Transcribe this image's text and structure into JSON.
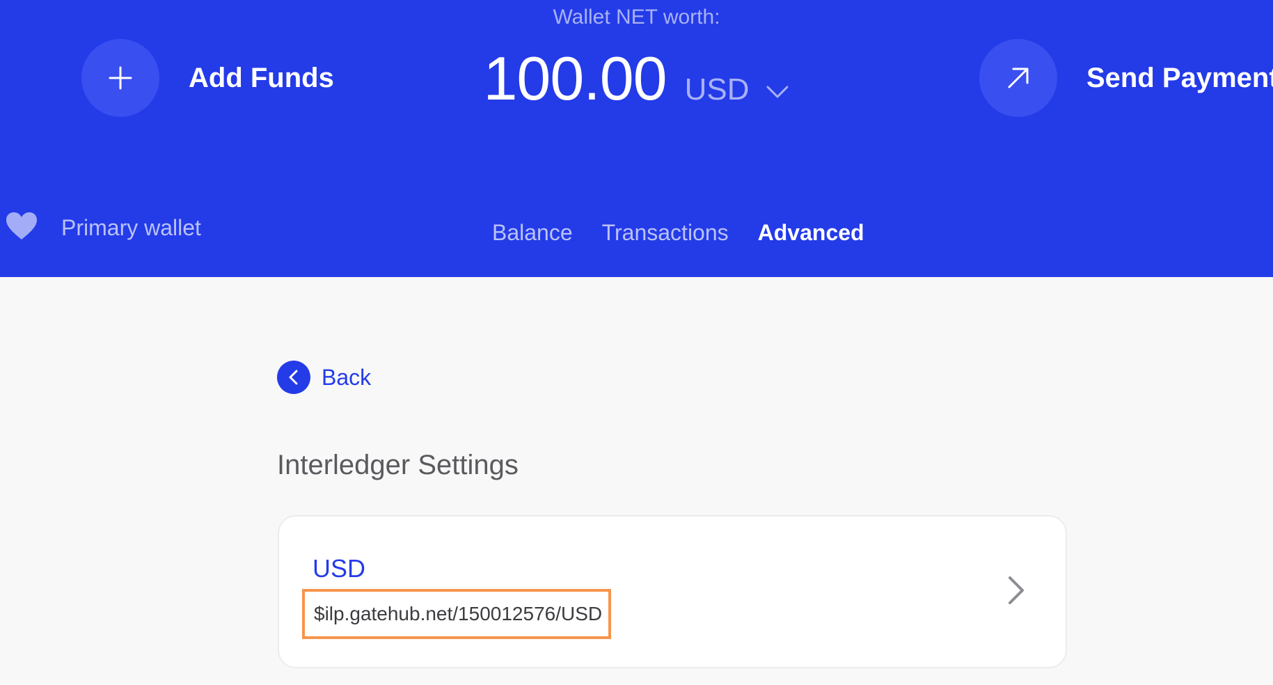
{
  "header": {
    "networth_label": "Wallet NET worth:",
    "amount": "100.00",
    "currency": "USD",
    "currency_dropdown_icon": "chevron-down-icon",
    "add_funds": {
      "label": "Add Funds",
      "icon": "plus-icon"
    },
    "send_payment": {
      "label": "Send Payment",
      "icon": "arrow-up-right-icon"
    },
    "wallet": {
      "label": "Primary wallet",
      "icon": "heart-icon"
    },
    "tabs": [
      {
        "label": "Balance",
        "active": false
      },
      {
        "label": "Transactions",
        "active": false
      },
      {
        "label": "Advanced",
        "active": true
      }
    ]
  },
  "content": {
    "back_label": "Back",
    "back_icon": "chevron-left-icon",
    "section_title": "Interledger Settings",
    "card": {
      "currency": "USD",
      "address": "$ilp.gatehub.net/150012576/USD",
      "arrow_icon": "chevron-right-icon"
    }
  },
  "colors": {
    "brand": "#243be8",
    "highlight": "#f7954a",
    "background": "#f8f8f9"
  }
}
